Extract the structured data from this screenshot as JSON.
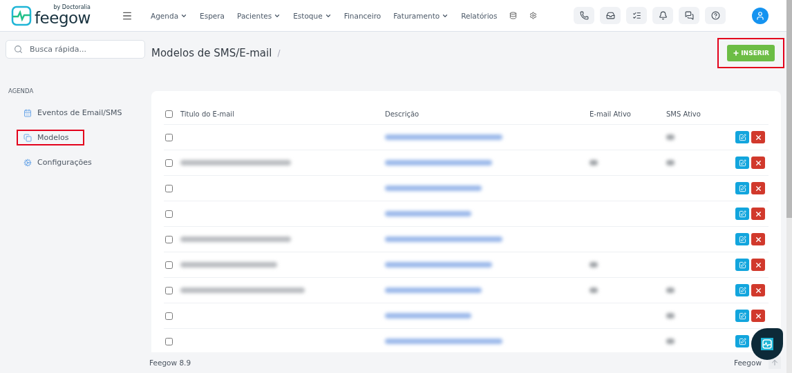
{
  "logo": {
    "brand": "feegow",
    "byline": "by Doctoralia"
  },
  "nav": [
    {
      "label": "Agenda",
      "dropdown": true
    },
    {
      "label": "Espera",
      "dropdown": false
    },
    {
      "label": "Pacientes",
      "dropdown": true
    },
    {
      "label": "Estoque",
      "dropdown": true
    },
    {
      "label": "Financeiro",
      "dropdown": false
    },
    {
      "label": "Faturamento",
      "dropdown": true
    },
    {
      "label": "Relatórios",
      "dropdown": false
    }
  ],
  "search": {
    "placeholder": "Busca rápida..."
  },
  "sidebar": {
    "section": "AGENDA",
    "items": [
      {
        "label": "Eventos de Email/SMS",
        "highlighted": false
      },
      {
        "label": "Modelos",
        "highlighted": true
      },
      {
        "label": "Configurações",
        "highlighted": false
      }
    ]
  },
  "page": {
    "title": "Modelos de SMS/E-mail",
    "separator": "/",
    "insert_button": {
      "label": "INSERIR",
      "highlighted": true
    }
  },
  "table": {
    "select_all_checked": false,
    "columns": [
      "Titulo do E-mail",
      "Descrição",
      "E-mail Ativo",
      "SMS Ativo"
    ],
    "rows": [
      {
        "checked": false,
        "title_blurred": false,
        "description_blurred": true,
        "email_blurred": false,
        "sms_blurred": true
      },
      {
        "checked": false,
        "title_blurred": true,
        "description_blurred": true,
        "email_blurred": true,
        "sms_blurred": true
      },
      {
        "checked": false,
        "title_blurred": false,
        "description_blurred": true,
        "email_blurred": false,
        "sms_blurred": false
      },
      {
        "checked": false,
        "title_blurred": false,
        "description_blurred": true,
        "email_blurred": false,
        "sms_blurred": false
      },
      {
        "checked": false,
        "title_blurred": true,
        "description_blurred": true,
        "email_blurred": false,
        "sms_blurred": false
      },
      {
        "checked": false,
        "title_blurred": true,
        "description_blurred": true,
        "email_blurred": true,
        "sms_blurred": false
      },
      {
        "checked": false,
        "title_blurred": true,
        "description_blurred": true,
        "email_blurred": true,
        "sms_blurred": true
      },
      {
        "checked": false,
        "title_blurred": false,
        "description_blurred": true,
        "email_blurred": false,
        "sms_blurred": true
      },
      {
        "checked": false,
        "title_blurred": false,
        "description_blurred": true,
        "email_blurred": false,
        "sms_blurred": true,
        "delete_hidden": true
      }
    ]
  },
  "footer": {
    "version": "Feegow 8.9",
    "brand": "Feegow"
  }
}
